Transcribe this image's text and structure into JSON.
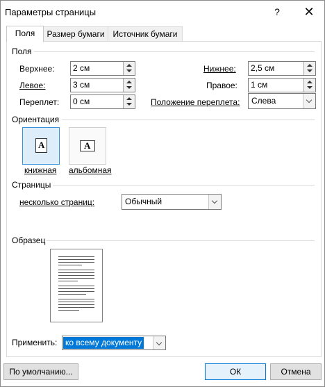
{
  "dialog": {
    "title": "Параметры страницы",
    "help": "?",
    "close": "✕"
  },
  "tabs": [
    {
      "label": "Поля",
      "active": true
    },
    {
      "label": "Размер бумаги",
      "active": false
    },
    {
      "label": "Источник бумаги",
      "active": false
    }
  ],
  "margins": {
    "group_label": "Поля",
    "top_label": "Верхнее:",
    "top_value": "2 см",
    "bottom_label": "Нижнее:",
    "bottom_value": "2,5 см",
    "left_label": "Левое:",
    "left_value": "3 см",
    "right_label": "Правое:",
    "right_value": "1 см",
    "gutter_label": "Переплет:",
    "gutter_value": "0 см",
    "gutter_pos_label": "Положение переплета:",
    "gutter_pos_value": "Слева"
  },
  "orientation": {
    "group_label": "Ориентация",
    "portrait_label": "книжная",
    "landscape_label": "альбомная",
    "icon_letter": "A",
    "selected": "portrait"
  },
  "pages": {
    "group_label": "Страницы",
    "multiple_label": "несколько страниц:",
    "multiple_value": "Обычный"
  },
  "preview": {
    "group_label": "Образец"
  },
  "apply": {
    "label": "Применить:",
    "value": "ко всему документу"
  },
  "buttons": {
    "default": "По умолчанию...",
    "ok": "ОК",
    "cancel": "Отмена"
  },
  "colors": {
    "accent": "#0078d7",
    "selected_bg": "#ddeefa"
  }
}
